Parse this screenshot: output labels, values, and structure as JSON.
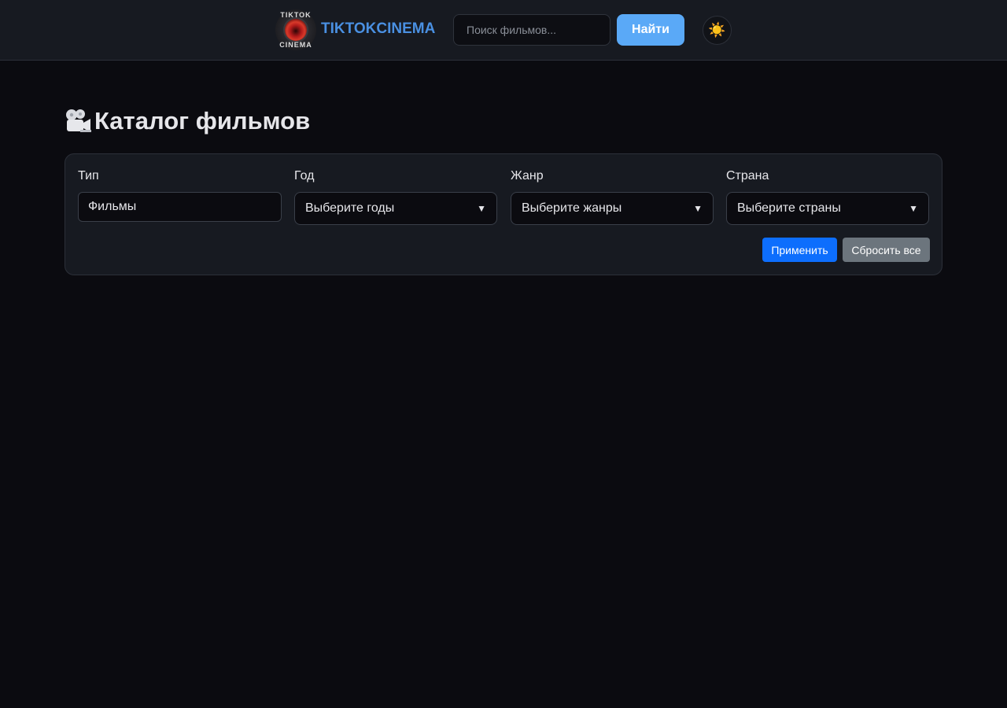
{
  "header": {
    "logo_ring_top": "TIKTOK",
    "logo_ring_bottom": "CINEMA",
    "brand": "TIKTOKCINEMA",
    "search_placeholder": "Поиск фильмов...",
    "search_value": "",
    "find_label": "Найти",
    "theme_icon": "☀️"
  },
  "page": {
    "title": "Каталог фильмов",
    "title_icon": "movie-camera-icon"
  },
  "filters": {
    "type": {
      "label": "Тип",
      "value": "Фильмы"
    },
    "year": {
      "label": "Год",
      "placeholder": "Выберите годы"
    },
    "genre": {
      "label": "Жанр",
      "placeholder": "Выберите жанры"
    },
    "country": {
      "label": "Страна",
      "placeholder": "Выберите страны"
    },
    "apply_label": "Применить",
    "reset_label": "Сбросить все"
  },
  "colors": {
    "background": "#0b0b10",
    "panel": "#171a21",
    "brand": "#4a90e2",
    "find_button": "#5aa9f7",
    "apply_button": "#0d6efd",
    "reset_button": "#6c757d"
  }
}
